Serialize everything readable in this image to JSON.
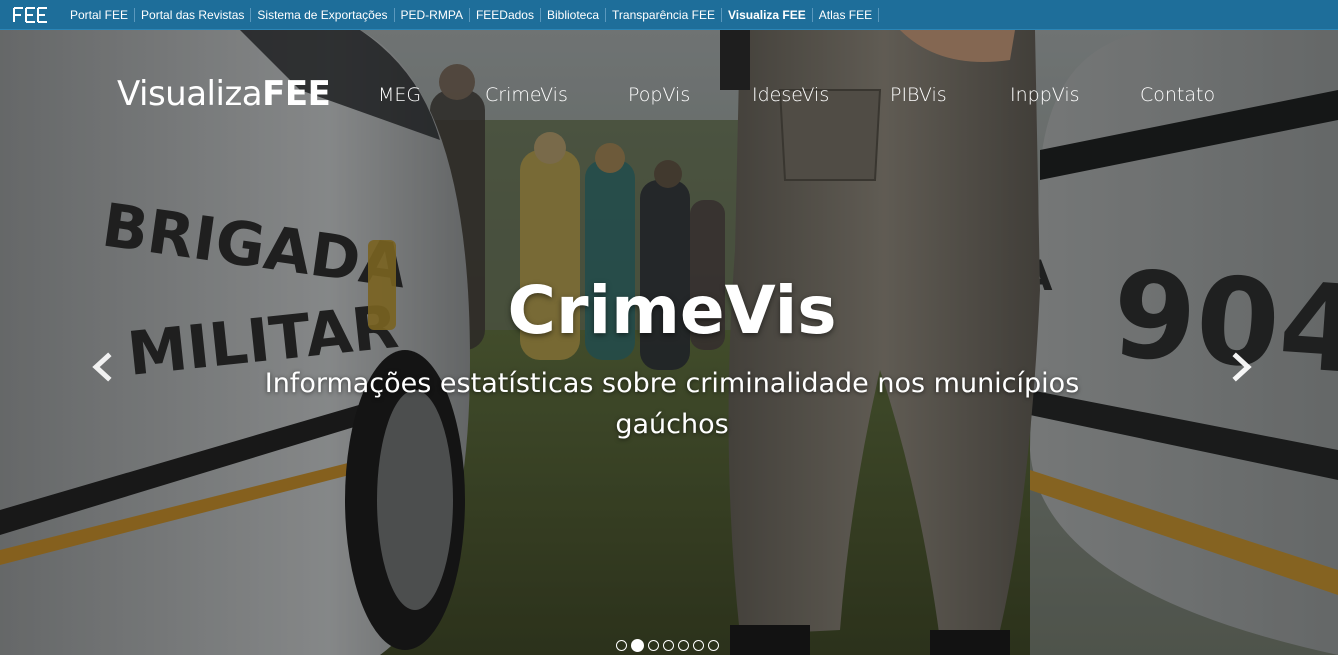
{
  "topbar": {
    "logo_icon": "fee-logo-icon",
    "links": [
      {
        "label": "Portal FEE"
      },
      {
        "label": "Portal das Revistas"
      },
      {
        "label": "Sistema de Exportações"
      },
      {
        "label": "PED-RMPA"
      },
      {
        "label": "FEEDados"
      },
      {
        "label": "Biblioteca"
      },
      {
        "label": "Transparência FEE"
      },
      {
        "label": "Visualiza FEE",
        "active": true
      },
      {
        "label": "Atlas FEE"
      }
    ],
    "color": "#1e6e9a"
  },
  "brand": {
    "light": "Visualiza",
    "strong": "FEE"
  },
  "nav": {
    "items": [
      {
        "label": "MEG"
      },
      {
        "label": "CrimeVis"
      },
      {
        "label": "PopVis"
      },
      {
        "label": "IdeseVis"
      },
      {
        "label": "PIBVis"
      },
      {
        "label": "InppVis"
      },
      {
        "label": "Contato"
      }
    ]
  },
  "carousel": {
    "title": "CrimeVis",
    "text": "Informações estatísticas sobre criminalidade nos municípios gaúchos",
    "prev_icon": "chevron-left-icon",
    "next_icon": "chevron-right-icon",
    "slide_count": 7,
    "active_slide": 2
  }
}
